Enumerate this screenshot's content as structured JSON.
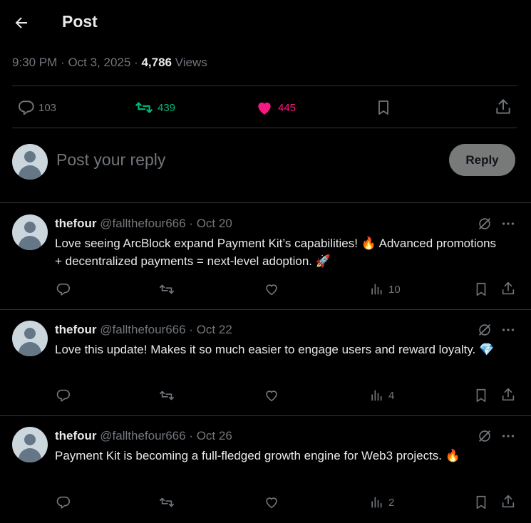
{
  "header": {
    "title": "Post"
  },
  "meta": {
    "time": "9:30 PM",
    "date": "Oct 3, 2025",
    "views_count": "4,786",
    "views_label": "Views"
  },
  "stats": {
    "replies": "103",
    "reposts": "439",
    "likes": "445"
  },
  "composer": {
    "placeholder": "Post your reply",
    "button": "Reply"
  },
  "replies": [
    {
      "name": "thefour",
      "handle": "@fallthefour666",
      "date": "Oct 20",
      "text": "Love seeing ArcBlock expand Payment Kit’s capabilities! 🔥 Advanced promotions + decentralized payments = next-level adoption. 🚀",
      "views": "10"
    },
    {
      "name": "thefour",
      "handle": "@fallthefour666",
      "date": "Oct 22",
      "text": "Love this update! Makes it so much easier to engage users and reward loyalty. 💎",
      "views": "4"
    },
    {
      "name": "thefour",
      "handle": "@fallthefour666",
      "date": "Oct 26",
      "text": "Payment Kit is becoming a full-fledged growth engine for Web3 projects. 🔥",
      "views": "2"
    }
  ],
  "colors": {
    "background": "#000000",
    "text": "#e7e9ea",
    "muted": "#71767b",
    "repost": "#00ba7c",
    "like": "#f91880",
    "divider": "#2f3336"
  }
}
